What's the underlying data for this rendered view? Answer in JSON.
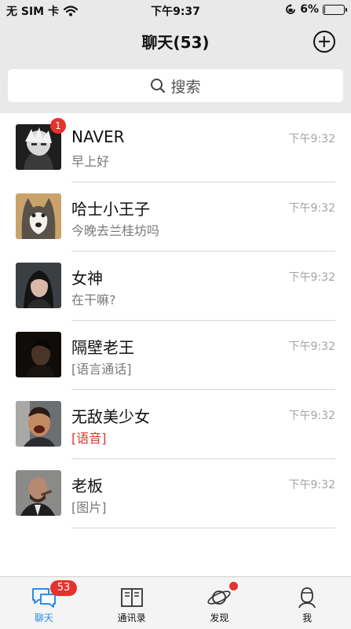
{
  "status_bar": {
    "carrier": "无 SIM 卡",
    "time": "下午9:37",
    "battery": "6%",
    "battery_level": 0.06
  },
  "header": {
    "title": "聊天(53)"
  },
  "search": {
    "placeholder": "搜索"
  },
  "chats": [
    {
      "name": "NAVER",
      "preview": "早上好",
      "time": "下午9:32",
      "unread": "1"
    },
    {
      "name": "哈士小王子",
      "preview": "今晚去兰桂坊吗",
      "time": "下午9:32"
    },
    {
      "name": "女神",
      "preview": "在干嘛?",
      "time": "下午9:32"
    },
    {
      "name": "隔壁老王",
      "preview": "[语言通话]",
      "time": "下午9:32"
    },
    {
      "name": "无敌美少女",
      "preview": "[语音]",
      "time": "下午9:32"
    },
    {
      "name": "老板",
      "preview": "[图片]",
      "time": "下午9:32"
    }
  ],
  "tabs": [
    {
      "label": "聊天",
      "badge": "53"
    },
    {
      "label": "通讯录"
    },
    {
      "label": "发现"
    },
    {
      "label": "我"
    }
  ],
  "colors": {
    "accent": "#2a8ee8",
    "badge": "#e5322d",
    "bar_bg": "#e9e9e9",
    "voice_preview": "#d93b2b"
  }
}
